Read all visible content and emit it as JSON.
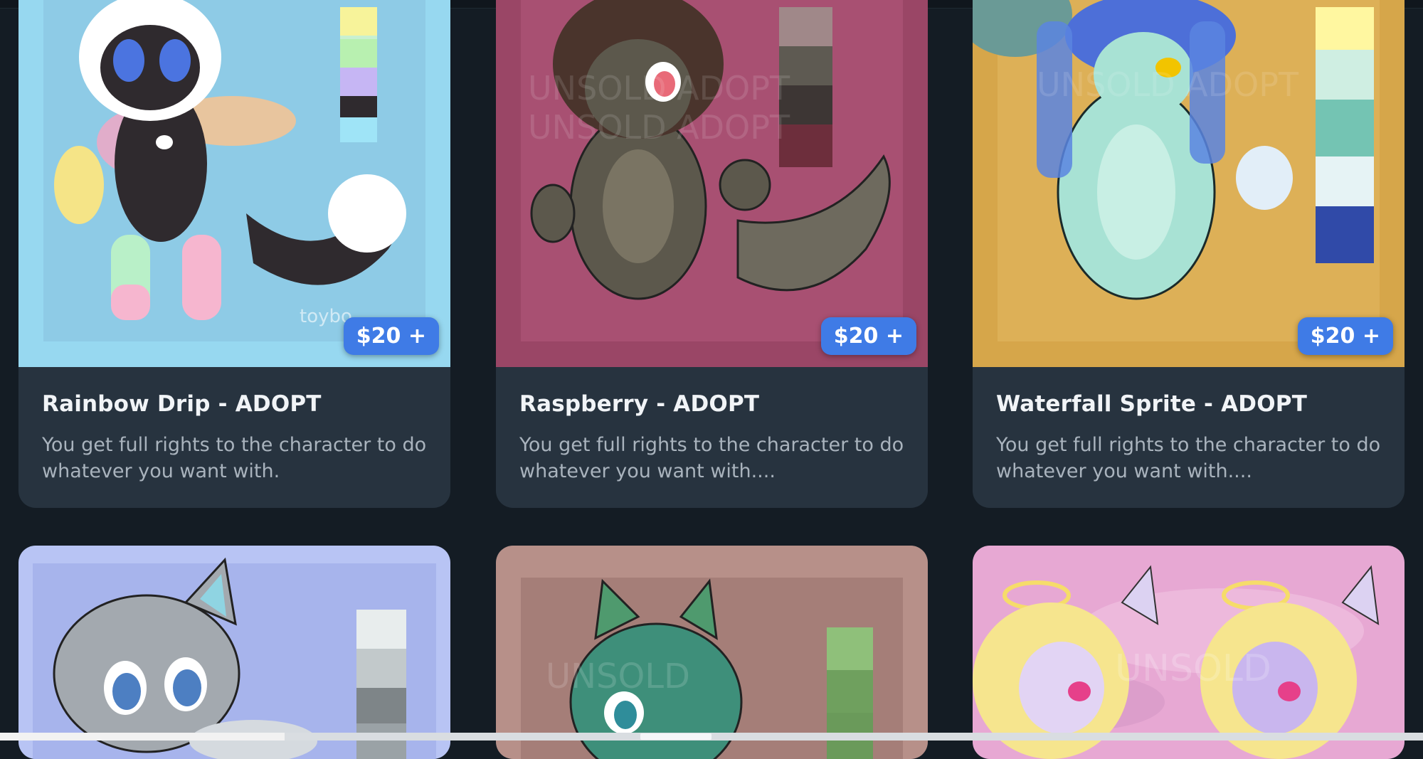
{
  "cards": [
    {
      "title": "Rainbow Drip - ADOPT",
      "description": "You get full rights to the character to do whatever you want with.",
      "price": "$20 +",
      "bg_color": "#97d8f0",
      "image_icon": "character-art-icon"
    },
    {
      "title": "Raspberry - ADOPT",
      "description": "You get full rights to the character to do whatever you want with....",
      "price": "$20 +",
      "bg_color": "#9a4666",
      "image_icon": "character-art-icon"
    },
    {
      "title": "Waterfall Sprite - ADOPT",
      "description": "You get full rights to the character to do whatever you want with....",
      "price": "$20 +",
      "bg_color": "#d6a64a",
      "image_icon": "character-art-icon"
    },
    {
      "title": "",
      "description": "",
      "price": "",
      "bg_color": "#b8c4f4",
      "image_icon": "character-art-icon"
    },
    {
      "title": "",
      "description": "",
      "price": "",
      "bg_color": "#b79089",
      "image_icon": "character-art-icon"
    },
    {
      "title": "",
      "description": "",
      "price": "",
      "bg_color": "#e7a8d3",
      "image_icon": "character-art-icon"
    }
  ],
  "colors": {
    "page_bg": "#141c24",
    "card_bg": "#27333f",
    "price_badge": "#3f7be6"
  }
}
